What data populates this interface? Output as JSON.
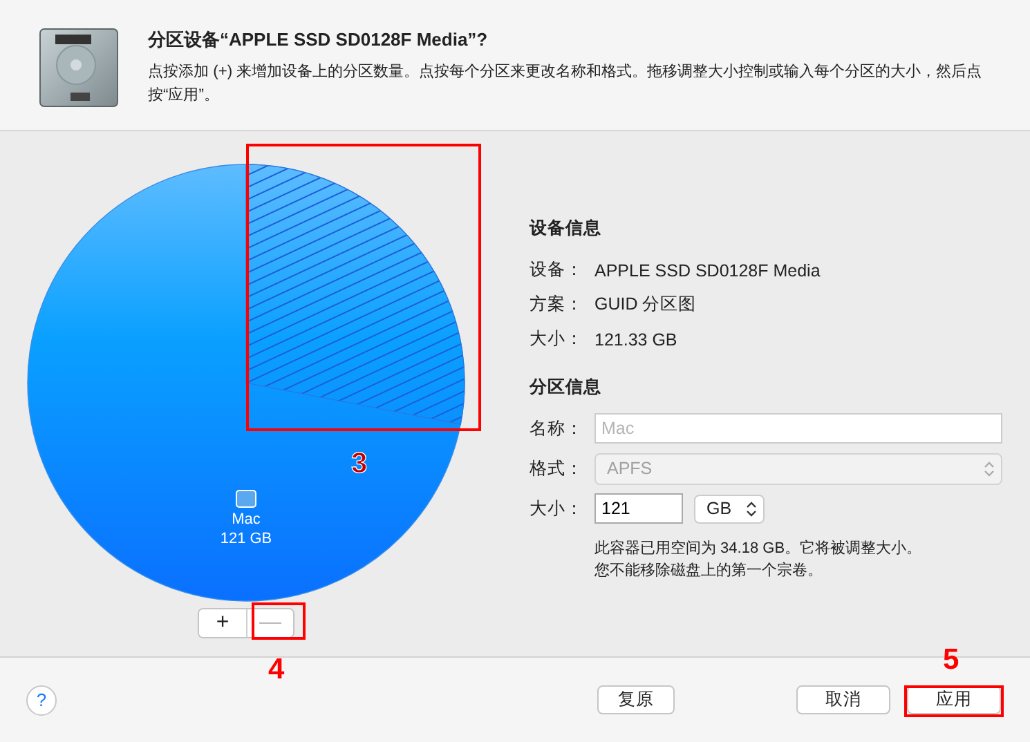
{
  "header": {
    "title": "分区设备“APPLE SSD SD0128F Media”?",
    "description": "点按添加 (+) 来增加设备上的分区数量。点按每个分区来更改名称和格式。拖移调整大小控制或输入每个分区的大小，然后点按“应用”。"
  },
  "partition_map": {
    "volumes": [
      {
        "name": "Mac",
        "size": "121 GB",
        "selected": true
      }
    ],
    "add_button": {
      "label": "+",
      "disabled": false
    },
    "remove_button": {
      "label": "—",
      "disabled": true
    }
  },
  "device_info": {
    "heading": "设备信息",
    "rows": [
      {
        "label": "设备：",
        "value": "APPLE SSD SD0128F Media"
      },
      {
        "label": "方案：",
        "value": "GUID 分区图"
      },
      {
        "label": "大小：",
        "value": "121.33 GB"
      }
    ]
  },
  "partition_info": {
    "heading": "分区信息",
    "name": {
      "label": "名称：",
      "placeholder": "Mac"
    },
    "format": {
      "label": "格式：",
      "value": "APFS",
      "disabled": true
    },
    "size": {
      "label": "大小：",
      "value": "121",
      "unit": "GB"
    },
    "notes": [
      "此容器已用空间为 34.18 GB。它将被调整大小。",
      "您不能移除磁盘上的第一个宗卷。"
    ]
  },
  "footer": {
    "help": "?",
    "buttons": [
      {
        "label": "复原",
        "kind": "revert"
      },
      {
        "label": "取消",
        "kind": "cancel"
      },
      {
        "label": "应用",
        "kind": "apply"
      }
    ]
  },
  "annotations": [
    {
      "label": "3"
    },
    {
      "label": "4"
    },
    {
      "label": "5"
    }
  ]
}
